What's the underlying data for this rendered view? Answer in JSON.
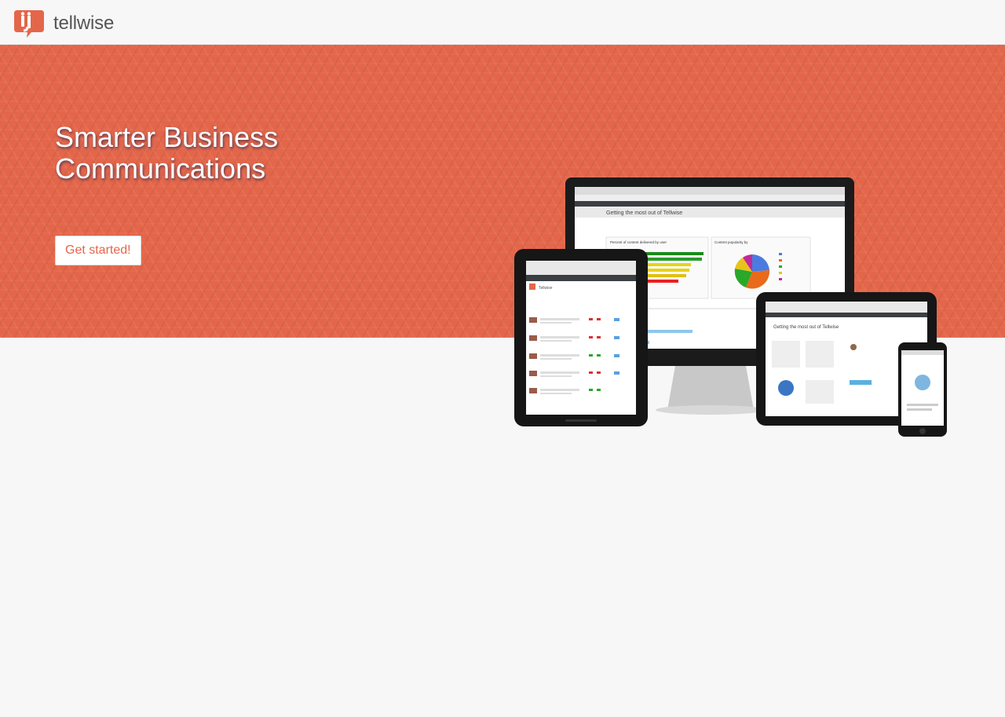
{
  "brand": {
    "name": "tellwise",
    "accent_color": "#e4664a"
  },
  "hero": {
    "title_line1": "Smarter Business",
    "title_line2": "Communications",
    "cta_label": "Get started!",
    "background_color": "#e4664a"
  },
  "showcase": {
    "monitor_page_title": "Getting the most out of Tellwise",
    "monitor_chart1_title": "Percent of content delivered by user",
    "monitor_chart2_title": "Content popularity by",
    "tablet_page_title": "Getting the most out of Tellwise",
    "small_tablet_brand": "Tellwise"
  }
}
